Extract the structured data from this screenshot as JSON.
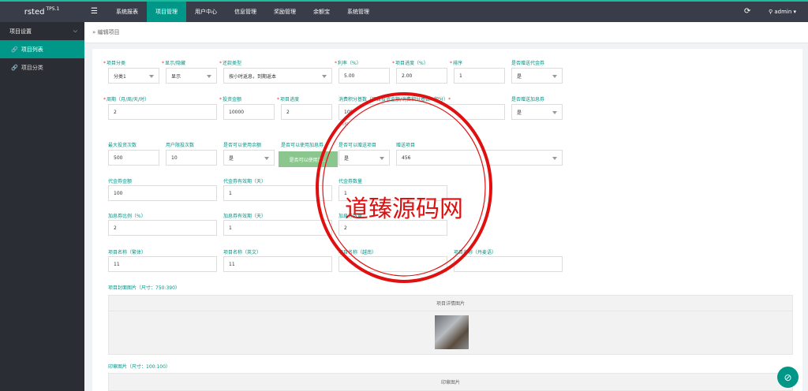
{
  "brand": {
    "name": "rsted",
    "version": "TP5.1"
  },
  "topnav": {
    "menu_icon": "☰",
    "items": [
      "系统报表",
      "项目管理",
      "用户中心",
      "信息管理",
      "奖励管理",
      "余额宝",
      "系统管理"
    ],
    "refresh_icon": "⟳",
    "user": "admin"
  },
  "sidebar": {
    "group": "项目设置",
    "items": [
      "项目列表",
      "项目分类"
    ]
  },
  "breadcrumb": "编辑项目",
  "form": {
    "row1": [
      {
        "label": "项目分类",
        "req": true,
        "type": "select",
        "value": "分类1"
      },
      {
        "label": "显示/隐藏",
        "req": true,
        "type": "select",
        "value": "显示"
      },
      {
        "label": "还款类型",
        "req": true,
        "type": "select",
        "value": "按小时返息，到期返本"
      },
      {
        "label": "利率（%）",
        "req": true,
        "type": "input",
        "value": "5.00"
      },
      {
        "label": "项目进度（%）",
        "req": true,
        "type": "input",
        "value": "2.00"
      },
      {
        "label": "排序",
        "req": true,
        "type": "input",
        "value": "1"
      },
      {
        "label": "是否赠送代金券",
        "req": false,
        "type": "select",
        "value": "是"
      }
    ],
    "row2": [
      {
        "label": "周期（月/周/天/时）",
        "req": true,
        "type": "input",
        "value": "2"
      },
      {
        "label": "投资金额",
        "req": true,
        "type": "input",
        "value": "10000"
      },
      {
        "label": "项目进度",
        "req": true,
        "type": "input",
        "value": "2"
      },
      {
        "label": "消费积分基数（项目投资金额/消费积分基数=积分）",
        "req": true,
        "type": "input",
        "value": "100"
      },
      {
        "label": "是否赠送加息券",
        "req": false,
        "type": "select",
        "value": "是"
      }
    ],
    "row2_hint": "=1积",
    "row3": [
      {
        "label": "最大投资次数",
        "type": "input",
        "value": "500"
      },
      {
        "label": "用户限投次数",
        "type": "input",
        "value": "10"
      },
      {
        "label": "是否可以使用余额",
        "type": "select",
        "value": "是"
      },
      {
        "label": "是否可以使用加息券",
        "type": "select",
        "value": ""
      },
      {
        "label": "是否可以赠送项目",
        "type": "select",
        "value": "是"
      },
      {
        "label": "赠送项目",
        "type": "select",
        "value": "456"
      }
    ],
    "green_button": "是否可以使用加...",
    "row4": [
      {
        "label": "代金券金额",
        "value": "100"
      },
      {
        "label": "代金券有效期（天）",
        "value": "1"
      },
      {
        "label": "代金券数量",
        "value": "1"
      }
    ],
    "row5": [
      {
        "label": "加息券比例（%）",
        "value": "2"
      },
      {
        "label": "加息券有效期（天）",
        "value": "1"
      },
      {
        "label": "加息券数量",
        "value": "2"
      }
    ],
    "row6": [
      {
        "label": "项目名称（繁体）",
        "value": "11"
      },
      {
        "label": "项目名称（英文）",
        "value": "11"
      },
      {
        "label": "项目名称（越南）",
        "value": ""
      },
      {
        "label": "项目名称（丹麦语）",
        "value": ""
      }
    ],
    "cover_label": "项目封面图片（尺寸：750:390）",
    "detail_title": "项目详情图片",
    "stamp_label": "印章图片（尺寸：100:100）",
    "stamp_title": "印章图片"
  },
  "watermark": {
    "text": "道臻源码网",
    "arc_top": "www.dzym.com",
    "arc_bottom": "www.dzym.com"
  }
}
